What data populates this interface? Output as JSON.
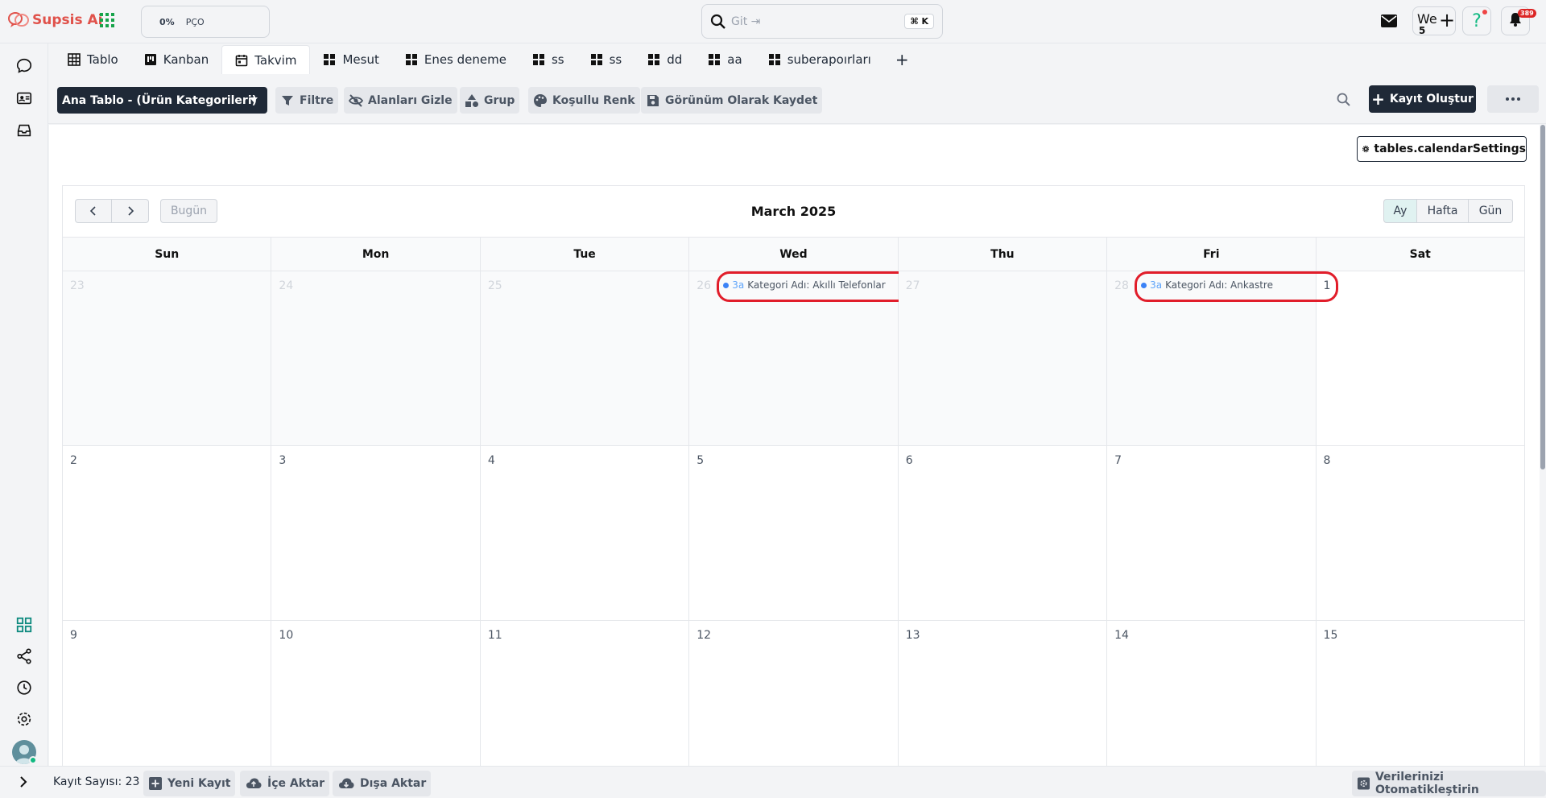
{
  "app": {
    "name": "Supsis Ai"
  },
  "progress": {
    "percent": "0%",
    "label": "PÇO"
  },
  "search": {
    "placeholder": "Git ⇥",
    "shortcut": "⌘ K"
  },
  "header": {
    "we_label": "We",
    "we_count": "5",
    "notification_count": "389"
  },
  "tabs": [
    {
      "label": "Tablo",
      "icon": "table-icon"
    },
    {
      "label": "Kanban",
      "icon": "kanban-icon"
    },
    {
      "label": "Takvim",
      "icon": "calendar-icon",
      "active": true
    },
    {
      "label": "Mesut",
      "icon": "grid-icon"
    },
    {
      "label": "Enes deneme",
      "icon": "grid-icon"
    },
    {
      "label": "ss",
      "icon": "grid-icon"
    },
    {
      "label": "ss",
      "icon": "grid-icon"
    },
    {
      "label": "dd",
      "icon": "grid-icon"
    },
    {
      "label": "aa",
      "icon": "grid-icon"
    },
    {
      "label": "suberapoırları",
      "icon": "grid-icon"
    }
  ],
  "toolbar": {
    "table_select": "Ana Tablo - (Ürün Kategorileri)",
    "filter": "Filtre",
    "hide_fields": "Alanları Gizle",
    "group": "Grup",
    "conditional_color": "Koşullu Renk",
    "save_view": "Görünüm Olarak Kaydet",
    "create_record": "Kayıt Oluştur"
  },
  "calendar": {
    "settings_label": "tables.calendarSettings",
    "title": "March 2025",
    "today_label": "Bugün",
    "views": [
      "Ay",
      "Hafta",
      "Gün"
    ],
    "active_view": "Ay",
    "weekdays": [
      "Sun",
      "Mon",
      "Tue",
      "Wed",
      "Thu",
      "Fri",
      "Sat"
    ],
    "weeks": [
      [
        "23",
        "24",
        "25",
        "26",
        "27",
        "28",
        "1"
      ],
      [
        "2",
        "3",
        "4",
        "5",
        "6",
        "7",
        "8"
      ],
      [
        "9",
        "10",
        "11",
        "12",
        "13",
        "14",
        "15"
      ]
    ],
    "events": [
      {
        "time": "3a",
        "title": "Kategori Adı: Akıllı Telefonlar"
      },
      {
        "time": "3a",
        "title": "Kategori Adı: Ankastre"
      }
    ],
    "colors": {
      "event_dot": "#3b82f6",
      "highlight": "#e11d2a"
    }
  },
  "footer": {
    "record_count": "Kayıt Sayısı: 23",
    "new_record": "Yeni Kayıt",
    "import": "İçe Aktar",
    "export": "Dışa Aktar",
    "automate": "Verilerinizi Otomatikleştirin"
  }
}
